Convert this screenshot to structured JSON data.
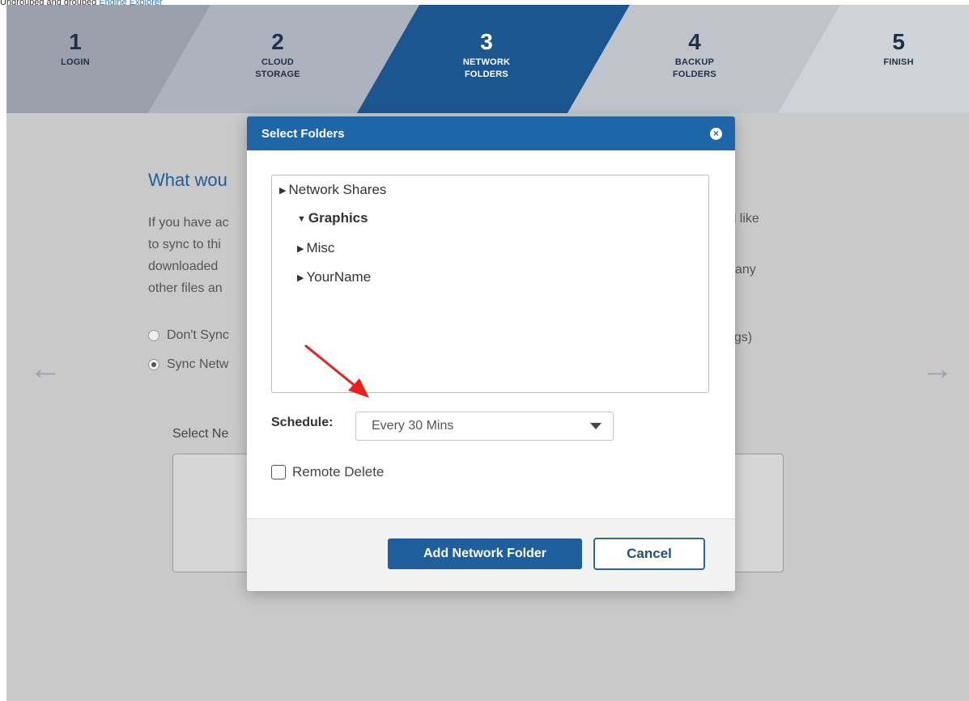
{
  "top_text": {
    "prefix": "Ungrouped and grouped",
    "link": "Engine Explorer"
  },
  "steps": [
    {
      "number": "1",
      "label": "LOGIN"
    },
    {
      "number": "2",
      "label": "CLOUD STORAGE"
    },
    {
      "number": "3",
      "label": "NETWORK FOLDERS"
    },
    {
      "number": "4",
      "label": "BACKUP FOLDERS"
    },
    {
      "number": "5",
      "label": "FINISH"
    }
  ],
  "page": {
    "title": "What wou",
    "para_line1": "If you have ac",
    "para_line1_right": "uld like",
    "para_line2": "to sync to thi",
    "para_line3": "downloaded",
    "para_line3_right": "any",
    "para_line4": "other files an",
    "radio1": "Don't Sync",
    "radio1_right": "tings)",
    "radio2": "Sync Netw",
    "select_label": "Select Ne"
  },
  "modal": {
    "title": "Select Folders",
    "tree": [
      {
        "label": "Network Shares",
        "expanded": false
      },
      {
        "label": "Graphics",
        "expanded": true
      },
      {
        "label": "Misc",
        "expanded": false
      },
      {
        "label": "YourName",
        "expanded": false
      }
    ],
    "schedule_label": "Schedule:",
    "schedule_value": "Every 30 Mins",
    "remote_delete_label": "Remote Delete",
    "add_button": "Add Network Folder",
    "cancel_button": "Cancel"
  },
  "colors": {
    "accent": "#1f66a9",
    "annotation_arrow": "#e8221b"
  }
}
